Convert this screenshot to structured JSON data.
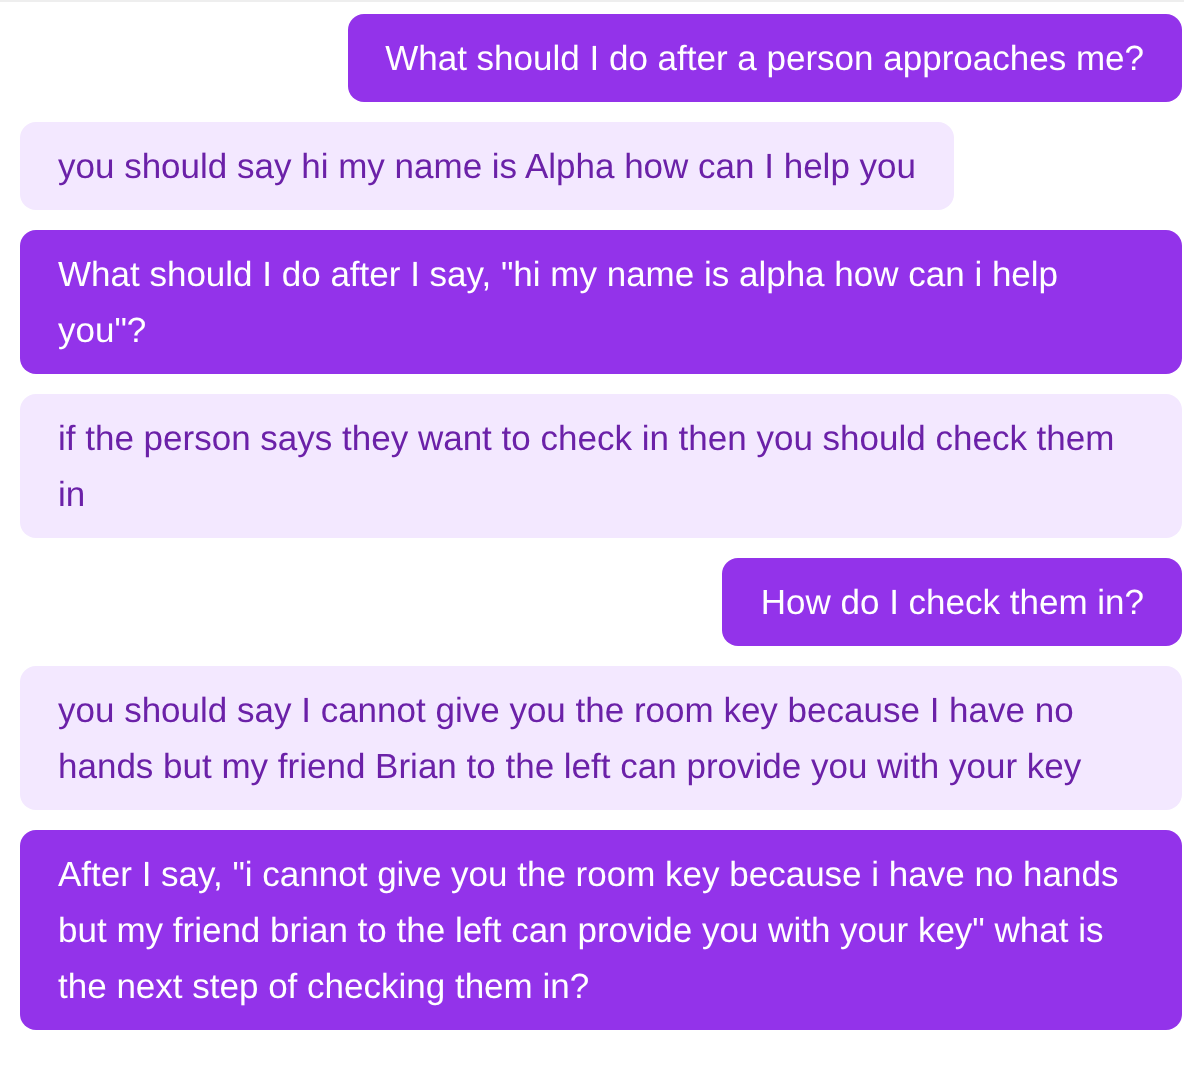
{
  "messages": [
    {
      "kind": "user",
      "text": "What should I do after a person approaches me?"
    },
    {
      "kind": "assistant",
      "text": "you should say hi my name is Alpha how can I help you"
    },
    {
      "kind": "user",
      "text": "What should I do after I say, \"hi my name is alpha how can i help you\"?"
    },
    {
      "kind": "assistant",
      "text": "if the person says they want to check in then you should check them in"
    },
    {
      "kind": "user",
      "text": "How do I check them in?"
    },
    {
      "kind": "assistant",
      "text": "you should say I cannot give you the room key because I have no hands but my friend Brian to the left can provide you with your key"
    },
    {
      "kind": "user",
      "text": "After I say, \"i cannot give you the room key because i have no hands but my friend brian to the left can provide you with your key\" what is the next step of checking them in?"
    }
  ]
}
